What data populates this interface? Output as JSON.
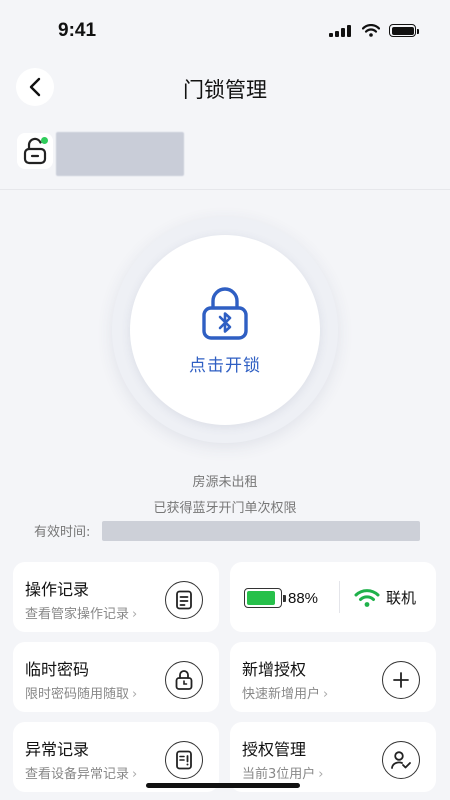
{
  "status_bar": {
    "time": "9:41"
  },
  "nav": {
    "title": "门锁管理"
  },
  "device": {
    "icon": "lock-open-icon"
  },
  "unlock": {
    "label": "点击开锁",
    "icon": "bluetooth-lock-icon"
  },
  "info": {
    "room_status": "房源未出租",
    "permission": "已获得蓝牙开门单次权限",
    "valid_label": "有效时间:"
  },
  "cards": {
    "operation": {
      "title": "操作记录",
      "subtitle": "查看管家操作记录",
      "icon": "document-icon"
    },
    "status": {
      "battery_percent": 88,
      "battery_label": "88%",
      "network_label": "联机",
      "battery_color": "#26c04a",
      "wifi_color": "#1fb14a"
    },
    "temp_password": {
      "title": "临时密码",
      "subtitle": "限时密码随用随取",
      "icon": "lock-clock-icon"
    },
    "new_auth": {
      "title": "新增授权",
      "subtitle": "快速新增用户",
      "icon": "plus-icon"
    },
    "exceptions": {
      "title": "异常记录",
      "subtitle": "查看设备异常记录",
      "icon": "alert-document-icon"
    },
    "auth_manage": {
      "title": "授权管理",
      "subtitle": "当前3位用户",
      "icon": "user-check-icon"
    }
  },
  "chevron": "›"
}
